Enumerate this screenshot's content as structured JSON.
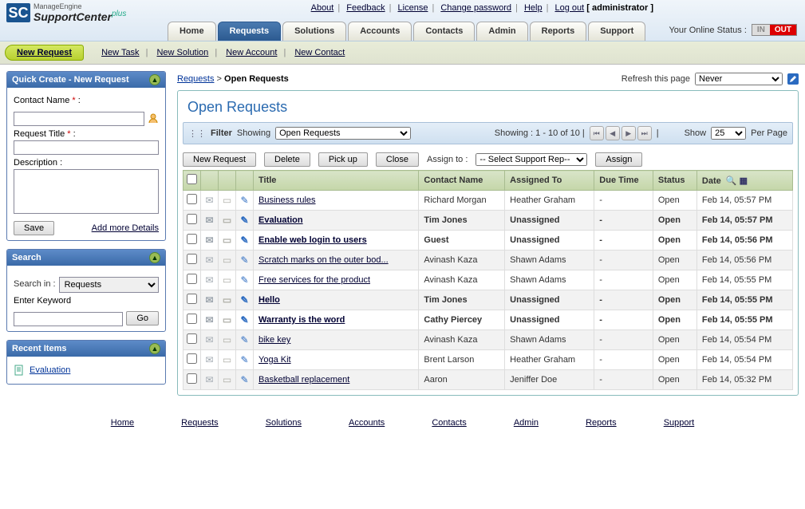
{
  "brand": {
    "sq": "SC",
    "small": "ManageEngine",
    "big": "SupportCenter",
    "plus": "plus"
  },
  "toplinks": {
    "about": "About",
    "feedback": "Feedback",
    "license": "License",
    "changepw": "Change password",
    "help": "Help",
    "logout": "Log out",
    "user": "[ administrator ]"
  },
  "nav": {
    "home": "Home",
    "requests": "Requests",
    "solutions": "Solutions",
    "accounts": "Accounts",
    "contacts": "Contacts",
    "admin": "Admin",
    "reports": "Reports",
    "support": "Support"
  },
  "status": {
    "label": "Your Online Status :",
    "in": "IN",
    "out": "OUT"
  },
  "subnav": {
    "newreq": "New Request",
    "newtask": "New Task",
    "newsol": "New Solution",
    "newacct": "New Account",
    "newcontact": "New Contact"
  },
  "quick": {
    "title": "Quick Create - New Request",
    "contact_label": "Contact Name",
    "contact_req": "*",
    "contact_colon": ":",
    "rtitle_label": "Request Title",
    "rtitle_req": "*",
    "rtitle_colon": ":",
    "desc_label": "Description :",
    "save": "Save",
    "more": "Add more Details"
  },
  "search": {
    "title": "Search",
    "searchin": "Search in :",
    "searchin_value": "Requests",
    "keyword": "Enter Keyword",
    "go": "Go"
  },
  "recent": {
    "title": "Recent Items",
    "items": [
      "Evaluation"
    ]
  },
  "crumb": {
    "root": "Requests",
    "sep": ">",
    "cur": "Open Requests"
  },
  "refresh": {
    "label": "Refresh this page",
    "value": "Never"
  },
  "main": {
    "title": "Open Requests",
    "filter_label": "Filter",
    "showing_label": "Showing",
    "filter_value": "Open Requests",
    "range": "Showing : 1 - 10 of 10 |",
    "show_label": "Show",
    "perpage_value": "25",
    "perpage_label": "Per Page",
    "actions": {
      "newreq": "New Request",
      "delete": "Delete",
      "pickup": "Pick up",
      "close": "Close",
      "assign_label": "Assign to :",
      "assign_select": "-- Select Support Rep--",
      "assign_btn": "Assign"
    },
    "cols": {
      "title": "Title",
      "contact": "Contact Name",
      "assigned": "Assigned To",
      "due": "Due Time",
      "status": "Status",
      "date": "Date"
    },
    "rows": [
      {
        "bold": false,
        "title": "Business rules",
        "contact": "Richard Morgan",
        "assigned": "Heather Graham",
        "due": "-",
        "status": "Open",
        "date": "Feb 14, 05:57 PM"
      },
      {
        "bold": true,
        "title": "Evaluation",
        "contact": "Tim Jones",
        "assigned": "Unassigned",
        "due": "-",
        "status": "Open",
        "date": "Feb 14, 05:57 PM"
      },
      {
        "bold": true,
        "title": "Enable web login to users",
        "contact": "Guest",
        "assigned": "Unassigned",
        "due": "-",
        "status": "Open",
        "date": "Feb 14, 05:56 PM"
      },
      {
        "bold": false,
        "title": "Scratch marks on the outer bod...",
        "contact": "Avinash Kaza",
        "assigned": "Shawn Adams",
        "due": "-",
        "status": "Open",
        "date": "Feb 14, 05:56 PM"
      },
      {
        "bold": false,
        "title": "Free services for the product",
        "contact": "Avinash Kaza",
        "assigned": "Shawn Adams",
        "due": "-",
        "status": "Open",
        "date": "Feb 14, 05:55 PM"
      },
      {
        "bold": true,
        "title": "Hello",
        "contact": "Tim Jones",
        "assigned": "Unassigned",
        "due": "-",
        "status": "Open",
        "date": "Feb 14, 05:55 PM"
      },
      {
        "bold": true,
        "title": "Warranty is the word",
        "contact": "Cathy Piercey",
        "assigned": "Unassigned",
        "due": "-",
        "status": "Open",
        "date": "Feb 14, 05:55 PM"
      },
      {
        "bold": false,
        "title": "bike key",
        "contact": "Avinash Kaza",
        "assigned": "Shawn Adams",
        "due": "-",
        "status": "Open",
        "date": "Feb 14, 05:54 PM"
      },
      {
        "bold": false,
        "title": "Yoga Kit",
        "contact": "Brent Larson",
        "assigned": "Heather Graham",
        "due": "-",
        "status": "Open",
        "date": "Feb 14, 05:54 PM"
      },
      {
        "bold": false,
        "title": "Basketball replacement",
        "contact": "Aaron",
        "assigned": "Jeniffer Doe",
        "due": "-",
        "status": "Open",
        "date": "Feb 14, 05:32 PM"
      }
    ]
  },
  "footer": {
    "home": "Home",
    "requests": "Requests",
    "solutions": "Solutions",
    "accounts": "Accounts",
    "contacts": "Contacts",
    "admin": "Admin",
    "reports": "Reports",
    "support": "Support"
  }
}
